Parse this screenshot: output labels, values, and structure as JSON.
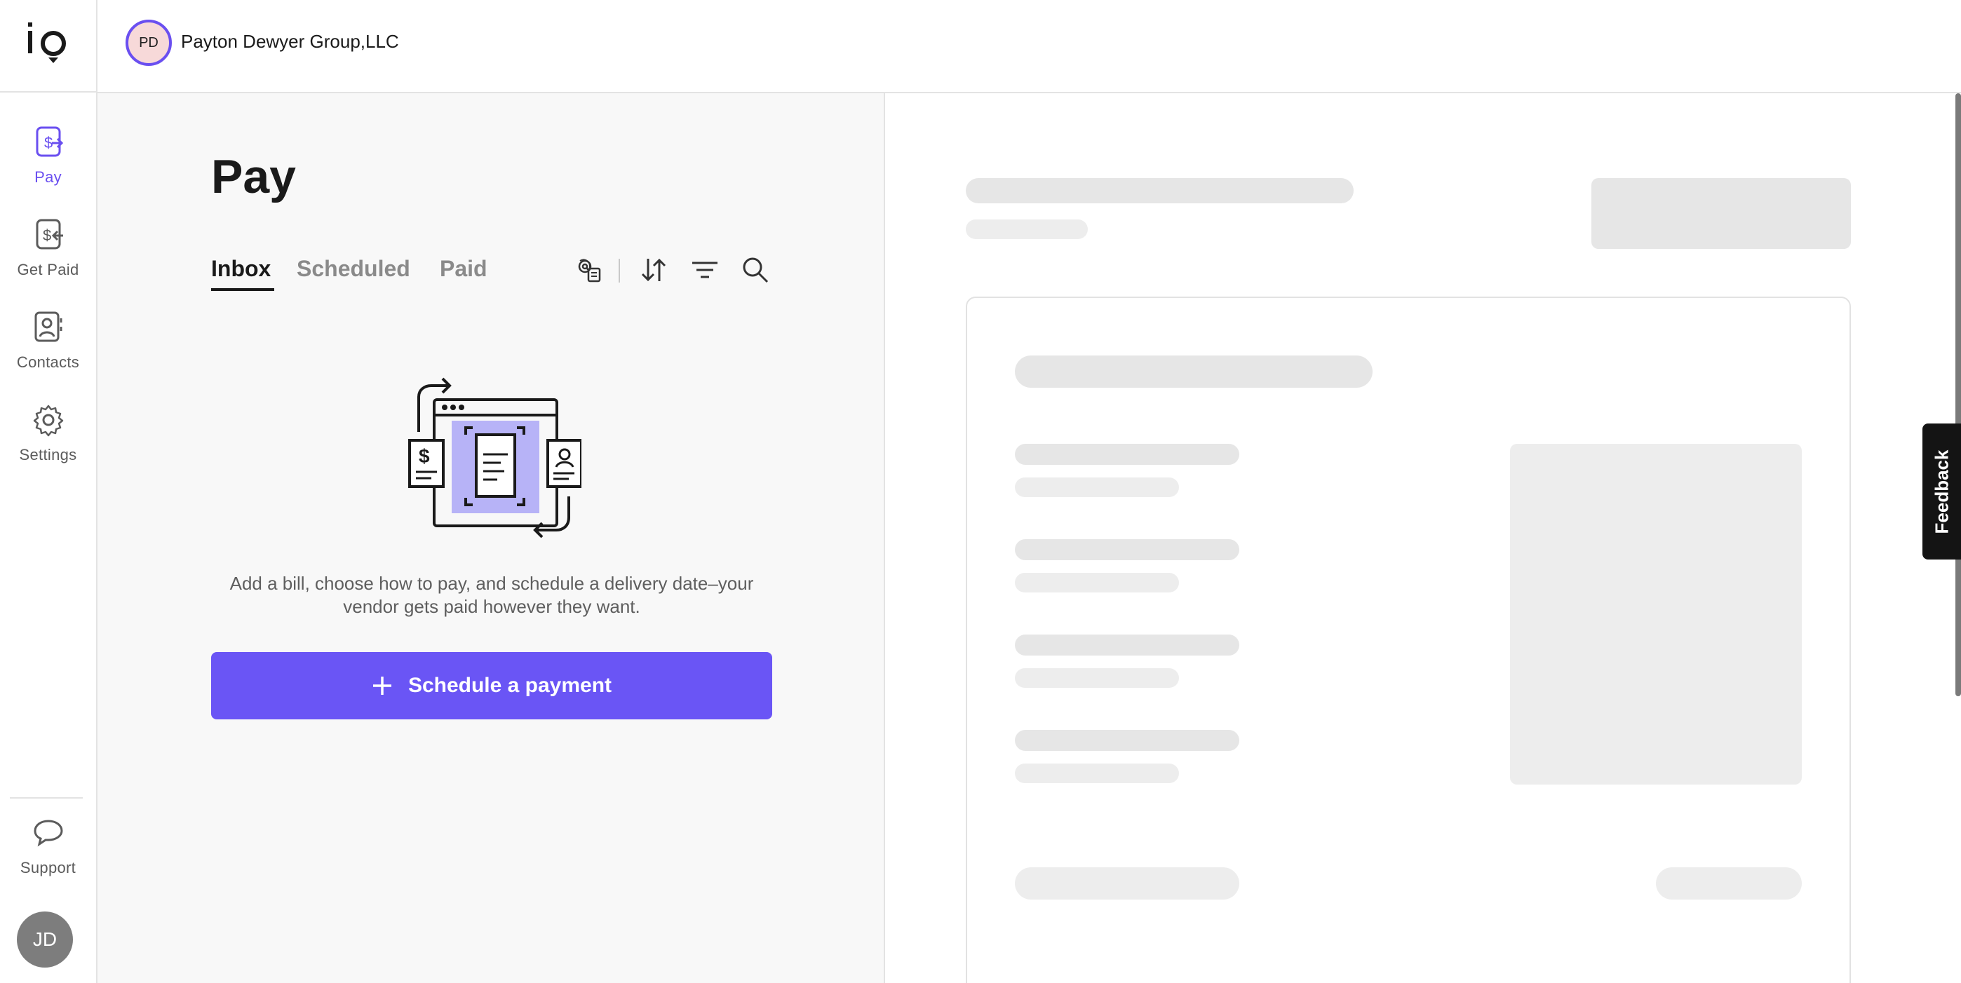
{
  "brand": {
    "logo_text": "io"
  },
  "nav": {
    "items": [
      {
        "label": "Pay",
        "icon": "pay-icon",
        "active": true
      },
      {
        "label": "Get Paid",
        "icon": "get-paid-icon",
        "active": false
      },
      {
        "label": "Contacts",
        "icon": "contacts-icon",
        "active": false
      },
      {
        "label": "Settings",
        "icon": "gear-icon",
        "active": false
      }
    ],
    "support": {
      "label": "Support",
      "icon": "chat-bubble-icon"
    },
    "user_initials": "JD"
  },
  "header": {
    "org_initials": "PD",
    "org_name": "Payton Dewyer Group,LLC"
  },
  "main": {
    "title": "Pay",
    "tabs": [
      {
        "label": "Inbox",
        "active": true
      },
      {
        "label": "Scheduled",
        "active": false
      },
      {
        "label": "Paid",
        "active": false
      }
    ],
    "toolbar_icons": [
      "email-inbox-icon",
      "sort-icon",
      "filter-icon",
      "search-icon"
    ],
    "empty_state": {
      "illustration": "bill-flow-illustration",
      "message": "Add a bill, choose how to pay, and schedule a delivery date–your vendor gets paid however they want."
    },
    "cta_label": "Schedule a payment"
  },
  "feedback_label": "Feedback",
  "colors": {
    "accent": "#6a55f5",
    "active_nav": "#6a4ff0",
    "skeleton": "#e6e6e6"
  }
}
